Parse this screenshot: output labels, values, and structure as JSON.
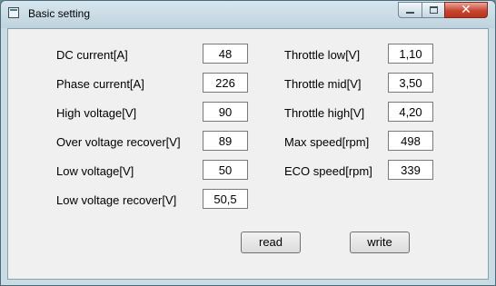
{
  "window": {
    "title": "Basic setting"
  },
  "titlebar_controls": {
    "minimize_icon": "minimize-icon",
    "maximize_icon": "maximize-icon",
    "close_glyph": "✕"
  },
  "left_fields": [
    {
      "label": "DC current[A]",
      "value": "48"
    },
    {
      "label": "Phase current[A]",
      "value": "226"
    },
    {
      "label": "High voltage[V]",
      "value": "90"
    },
    {
      "label": "Over voltage recover[V]",
      "value": "89"
    },
    {
      "label": "Low voltage[V]",
      "value": "50"
    },
    {
      "label": "Low voltage recover[V]",
      "value": "50,5"
    }
  ],
  "right_fields": [
    {
      "label": "Throttle low[V]",
      "value": "1,10"
    },
    {
      "label": "Throttle mid[V]",
      "value": "3,50"
    },
    {
      "label": "Throttle high[V]",
      "value": "4,20"
    },
    {
      "label": "Max speed[rpm]",
      "value": "498"
    },
    {
      "label": "ECO speed[rpm]",
      "value": "339"
    }
  ],
  "buttons": {
    "read": "read",
    "write": "write"
  }
}
